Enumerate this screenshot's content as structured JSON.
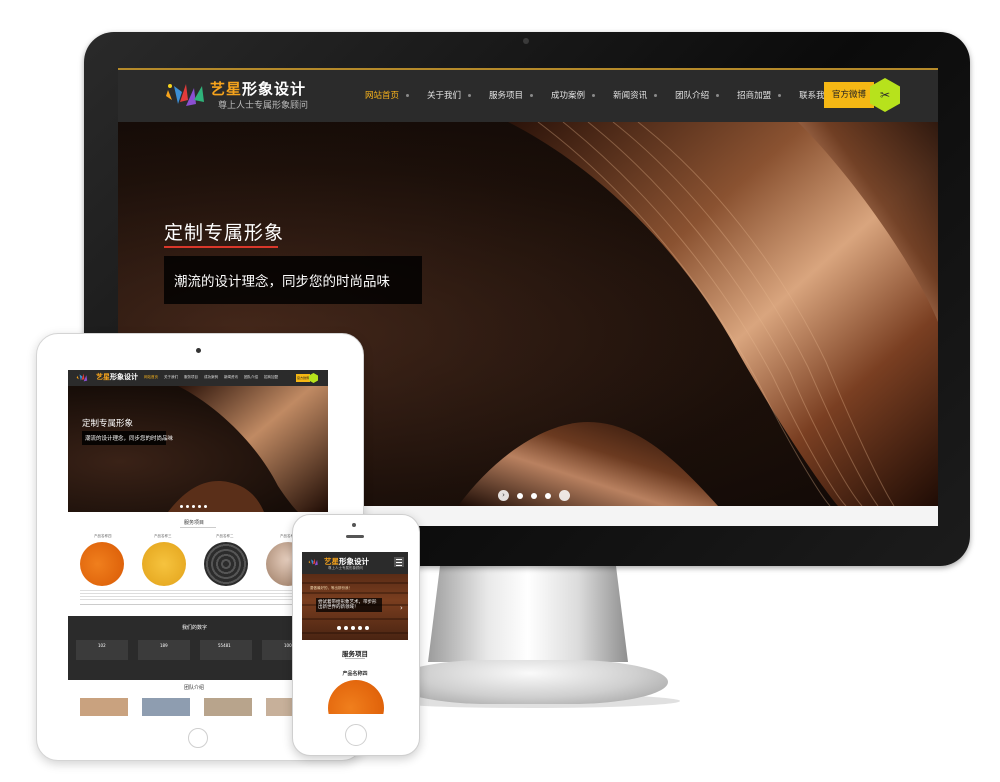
{
  "brand": {
    "name_part1": "艺星",
    "name_part2": "形象设计",
    "tagline": "尊上人士专属形象顾问"
  },
  "nav": {
    "items": [
      "网站首页",
      "关于我们",
      "服务项目",
      "成功案例",
      "新闻资讯",
      "团队介绍",
      "招商加盟",
      "联系我们"
    ],
    "active_index": 0,
    "weibo_label": "官方微博"
  },
  "hero": {
    "title": "定制专属形象",
    "subtitle": "潮流的设计理念，同步您的时尚品味",
    "slide_count": 4
  },
  "tablet": {
    "services_title": "服务项目",
    "product_titles": [
      "产品名称四",
      "产品名称三",
      "产品名称二",
      "产品名称一"
    ],
    "stats_title": "我们的数字",
    "stats_values": [
      "102",
      "189",
      "55481",
      "100"
    ],
    "team_title": "团队介绍"
  },
  "phone": {
    "hero_line1": "要做最好的，等出那份我！",
    "hero_line2": "尝试着带给形象艺术，带步形出新世界的新领域！",
    "services_title": "服务项目",
    "product_title": "产品名称四"
  },
  "colors": {
    "accent": "#f7b21c",
    "nav_bg": "#2b2b2b",
    "hex_green": "#b7e21c",
    "underline_red": "#d9372a"
  }
}
